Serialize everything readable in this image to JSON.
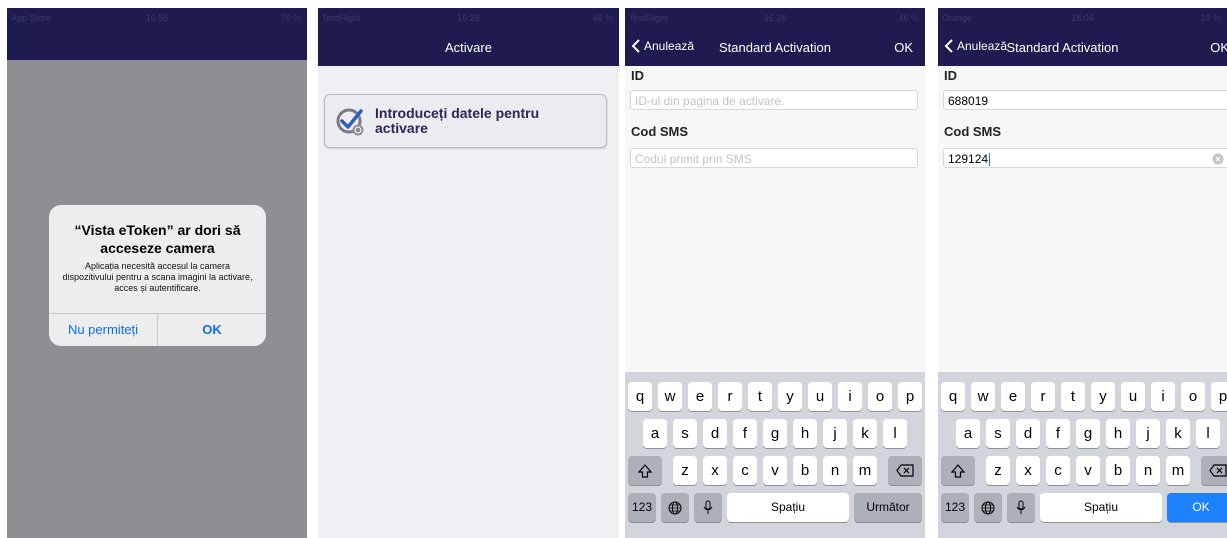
{
  "screen1": {
    "status": {
      "carrier": "App Store",
      "time": "16:55",
      "battery": "70 %"
    },
    "alert": {
      "title": "“Vista eToken” ar dori să acceseze camera",
      "message": "Aplicația necesită accesul la camera dispozitivului pentru a scana imagini la activare, acces și autentificare.",
      "deny_label": "Nu permiteți",
      "ok_label": "OK"
    }
  },
  "screen2": {
    "status": {
      "carrier": "TestFlight",
      "time": "16:25",
      "battery": "46 %"
    },
    "nav_title": "Activare",
    "card_label": "Introduceți datele pentru activare"
  },
  "screen3": {
    "status": {
      "carrier": "TestFlight",
      "time": "16:26",
      "battery": "46 %"
    },
    "nav_back": "Anulează",
    "nav_title": "Standard Activation",
    "nav_ok": "OK",
    "id_label": "ID",
    "id_placeholder": "ID-ul din pagina de activare.",
    "sms_label": "Cod SMS",
    "sms_placeholder": "Codul primit prin SMS",
    "space_label": "Spațiu",
    "return_label": "Următor",
    "numbers_label": "123"
  },
  "screen4": {
    "status": {
      "carrier": "Orange",
      "time": "18:04",
      "battery": "19 %"
    },
    "nav_back": "Anulează",
    "nav_title": "Standard Activation",
    "nav_ok": "OK",
    "id_label": "ID",
    "id_value": "688019",
    "sms_label": "Cod SMS",
    "sms_value": "129124",
    "space_label": "Spațiu",
    "return_label": "OK",
    "numbers_label": "123"
  },
  "keyboard": {
    "row1": [
      "q",
      "w",
      "e",
      "r",
      "t",
      "y",
      "u",
      "i",
      "o",
      "p"
    ],
    "row2": [
      "a",
      "s",
      "d",
      "f",
      "g",
      "h",
      "j",
      "k",
      "l"
    ],
    "row3": [
      "z",
      "x",
      "c",
      "v",
      "b",
      "n",
      "m"
    ]
  },
  "colors": {
    "nav": "#1d1b4f",
    "accent": "#0a6ff0",
    "return_blue": "#1b82fb"
  }
}
